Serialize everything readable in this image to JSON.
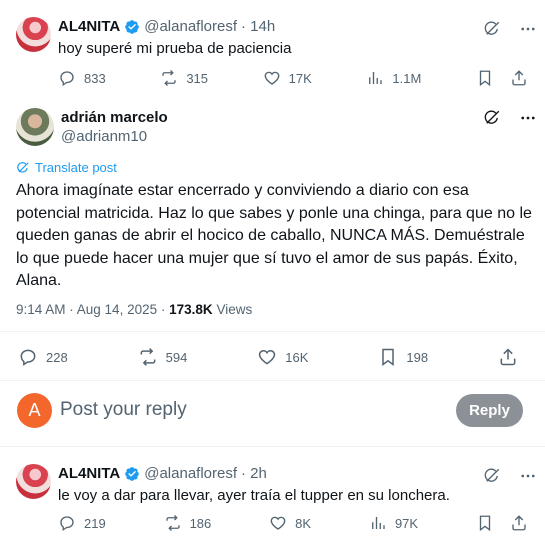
{
  "parent_tweet": {
    "name": "AL4NITA",
    "handle": "@alanafloresf",
    "time": "· 14h",
    "text": "hoy superé mi prueba de paciencia",
    "replies": "833",
    "reposts": "315",
    "likes": "17K",
    "views": "1.1M"
  },
  "main_tweet": {
    "name": "adrián marcelo",
    "handle": "@adrianm10",
    "translate_label": "Translate post",
    "text_lines": [
      "Ahora imagínate estar encerrado y conviviendo a diario con esa",
      "potencial matricida. Haz lo que sabes y ponle una chinga, para que no le",
      "queden ganas de abrir el hocico de caballo, NUNCA MÁS. Demuéstrale",
      "lo que puede hacer una mujer que sí tuvo el amor de sus papás. Éxito,",
      "Alana."
    ],
    "timestamp": "9:14 AM · Aug 14, 2025 ·",
    "views_count": "173.8K",
    "views_label": "Views",
    "replies": "228",
    "reposts": "594",
    "likes": "16K",
    "bookmarks": "198"
  },
  "composer": {
    "avatar_letter": "A",
    "placeholder": "Post your reply",
    "button_label": "Reply"
  },
  "reply_tweet": {
    "name": "AL4NITA",
    "handle": "@alanafloresf",
    "time": "· 2h",
    "text": "le voy a dar para llevar, ayer traía el tupper en su lonchera.",
    "replies": "219",
    "reposts": "186",
    "likes": "8K",
    "views": "97K"
  },
  "colors": {
    "verified": "#1d9bf0",
    "link": "#1d9bf0",
    "muted": "#536471",
    "reply_button": "#8b9196",
    "composer_avatar": "#f4672c"
  }
}
